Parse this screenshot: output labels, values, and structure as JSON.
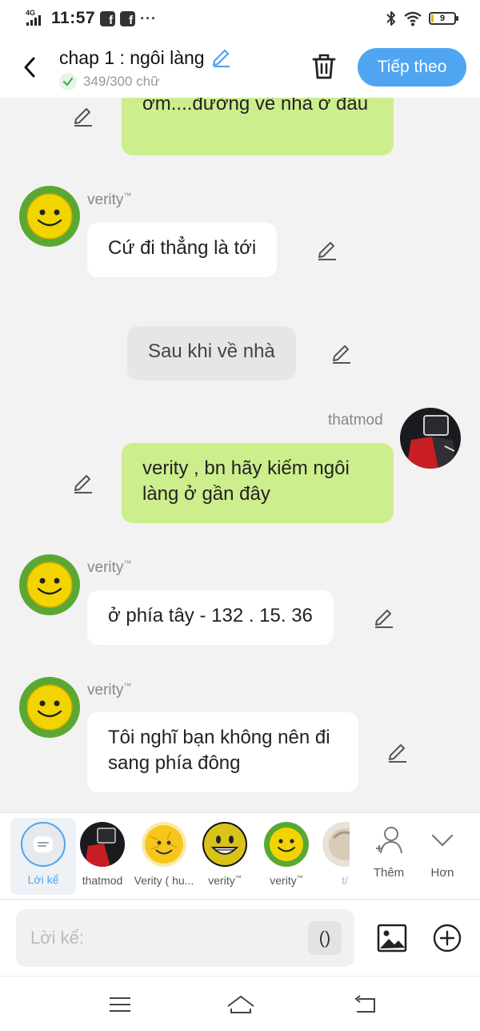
{
  "status_bar": {
    "network": "4G",
    "time": "11:57",
    "notif_1": "f",
    "notif_2": "f",
    "more": "···",
    "battery": "9"
  },
  "header": {
    "title": "chap 1 : ngôi làng",
    "word_count": "349/300 chữ",
    "next_label": "Tiếp theo"
  },
  "messages": {
    "m1_text": "ơm....đường về nhà ở đâu",
    "m2_name": "verity",
    "m2_text": "Cứ đi thẳng là tới",
    "m3_text": "Sau khi về nhà",
    "m4_name": "thatmod",
    "m4_text": "verity , bn hãy kiếm ngôi làng ở gần đây",
    "m5_name": "verity",
    "m5_text": "ở phía tây - 132 . 15. 36",
    "m6_name": "verity",
    "m6_text": "Tôi nghĩ bạn không nên đi sang phía đông",
    "tm": "™"
  },
  "characters": {
    "narration": "Lời kể",
    "c1": "thatmod",
    "c2": "Verity ( hu...",
    "c3": "verity",
    "c4": "verity",
    "c5": "t/",
    "add": "Thêm",
    "more": "Hơn",
    "tm": "™"
  },
  "composer": {
    "placeholder": "Lời kể:",
    "paren": "()"
  },
  "colors": {
    "accent": "#4fa5f2",
    "green_bubble": "#cdee8c",
    "white_bubble": "#ffffff",
    "gray_bubble": "#e6e6e6"
  },
  "icons": [
    "back-icon",
    "edit-icon",
    "check-icon",
    "trash-icon",
    "pencil-icon",
    "narration-icon",
    "add-person-icon",
    "chevron-down-icon",
    "image-icon",
    "add-circle-icon",
    "menu-icon",
    "home-icon",
    "return-icon",
    "bluetooth-icon",
    "wifi-icon",
    "battery-icon"
  ]
}
